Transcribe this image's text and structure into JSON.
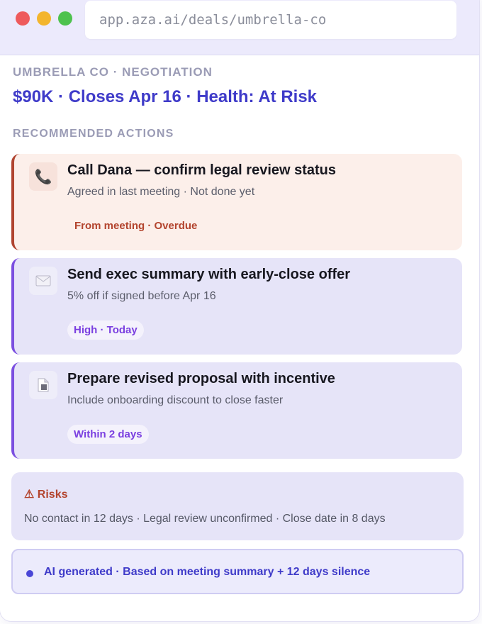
{
  "browser": {
    "url": "app.aza.ai/deals/umbrella-co"
  },
  "deal": {
    "eyebrow": "UMBRELLA CO · NEGOTIATION",
    "headline": "$90K · Closes Apr 16 · Health: At Risk"
  },
  "actions": {
    "section_label": "RECOMMENDED ACTIONS",
    "items": [
      {
        "icon": "phone-icon",
        "title": "Call Dana — confirm legal review status",
        "subtitle": "Agreed in last meeting · Not done yet",
        "tag": "From meeting · Overdue",
        "status_color": "#b3442e"
      },
      {
        "icon": "envelope-icon",
        "title": "Send exec summary with early-close offer",
        "subtitle": "5% off if signed before Apr 16",
        "tag": "High · Today",
        "status_color": "#7a3fe0"
      },
      {
        "icon": "document-icon",
        "title": "Prepare revised proposal with incentive",
        "subtitle": "Include onboarding discount to close faster",
        "tag": "Within 2 days",
        "status_color": "#7a3fe0"
      }
    ]
  },
  "risks": {
    "title": "⚠ Risks",
    "body": "No contact in 12 days · Legal review unconfirmed · Close date in 8 days"
  },
  "ai_note": {
    "text": "AI generated · Based on meeting summary + 12 days silence"
  },
  "colors": {
    "accent": "#3f3bc9",
    "danger": "#b3442e",
    "purple": "#7a3fe0"
  }
}
